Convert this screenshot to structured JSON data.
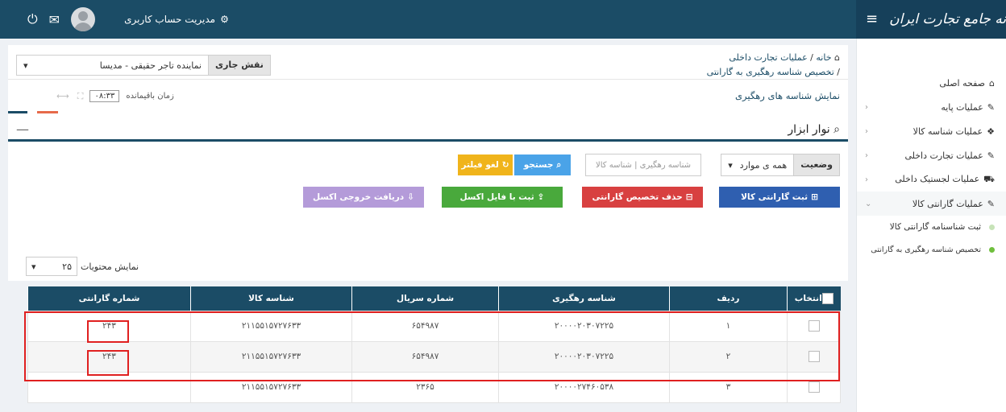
{
  "topbar": {
    "brand_title": "سامانه جامع تجارت ایران",
    "user_menu_label": "مدیریت حساب کاربری"
  },
  "sidebar": {
    "items": [
      {
        "label": "صفحه اصلی",
        "icon": "home-icon",
        "arrow": ""
      },
      {
        "label": "عملیات پایه",
        "icon": "edit-icon",
        "arrow": "‹"
      },
      {
        "label": "عملیات شناسه کالا",
        "icon": "cubes-icon",
        "arrow": "‹"
      },
      {
        "label": "عملیات تجارت داخلی",
        "icon": "edit-icon",
        "arrow": "‹"
      },
      {
        "label": "عملیات لجستیک داخلی",
        "icon": "truck-icon",
        "arrow": "‹"
      },
      {
        "label": "عملیات گارانتی کالا",
        "icon": "edit-icon",
        "arrow": "⌄"
      }
    ],
    "subitems": [
      {
        "label": "ثبت شناسنامه گارانتی کالا"
      },
      {
        "label": "تخصیص شناسه رهگیری به گارانتی"
      }
    ]
  },
  "header": {
    "breadcrumb_home": "خانه",
    "breadcrumb_mid": "عملیات تجارت داخلی",
    "breadcrumb_current": "تخصیص شناسه رهگیری به گارانتی",
    "role_label": "نقش جاری",
    "role_value": "نماینده تاجر حقیقی - مدیسا",
    "page_title": "نمایش شناسه های رهگیری",
    "time_label": "زمان باقیمانده",
    "time_value": "۰۸:۳۳"
  },
  "toolbar": {
    "title": "نوار ابزار",
    "status_label": "وضعیت",
    "status_value": "همه ی موارد",
    "search_placeholder": "شناسه رهگیری | شناسه کالا",
    "search_btn": "جستجو",
    "clear_btn": "لغو فیلتر",
    "register_btn": "ثبت گارانتی کالا",
    "delete_btn": "حذف تخصیص گارانتی",
    "excel_import_btn": "ثبت با فایل اکسل",
    "excel_export_btn": "دریافت خروجی اکسل"
  },
  "table": {
    "page_size_label": "نمایش محتویات",
    "page_size_value": "۲۵",
    "headers": [
      "انتخاب",
      "ردیف",
      "شناسه رهگیری",
      "شماره سریال",
      "شناسه کالا",
      "شماره گارانتی"
    ],
    "rows": [
      {
        "row": "۱",
        "tracking": "۲۰۰۰۰۲۰۳۰۷۲۲۵",
        "serial": "۶۵۴۹۸۷",
        "product": "۲۱۱۵۵۱۵۷۲۷۶۳۳",
        "warranty": "۲۴۳"
      },
      {
        "row": "۲",
        "tracking": "۲۰۰۰۰۲۰۳۰۷۲۲۵",
        "serial": "۶۵۴۹۸۷",
        "product": "۲۱۱۵۵۱۵۷۲۷۶۳۳",
        "warranty": "۲۴۳"
      },
      {
        "row": "۳",
        "tracking": "۲۰۰۰۰۲۷۴۶۰۵۳۸",
        "serial": "۲۳۶۵",
        "product": "۲۱۱۵۵۱۵۷۲۷۶۳۳",
        "warranty": ""
      }
    ]
  },
  "colors": {
    "primary": "#1b4c66",
    "blue_btn": "#2f5fb0",
    "red_btn": "#d84040",
    "green_btn": "#49a93c",
    "purple_btn": "#b49bd9",
    "search_btn": "#4aa3e8",
    "clear_btn": "#f0b41b",
    "highlight": "#e02020"
  }
}
